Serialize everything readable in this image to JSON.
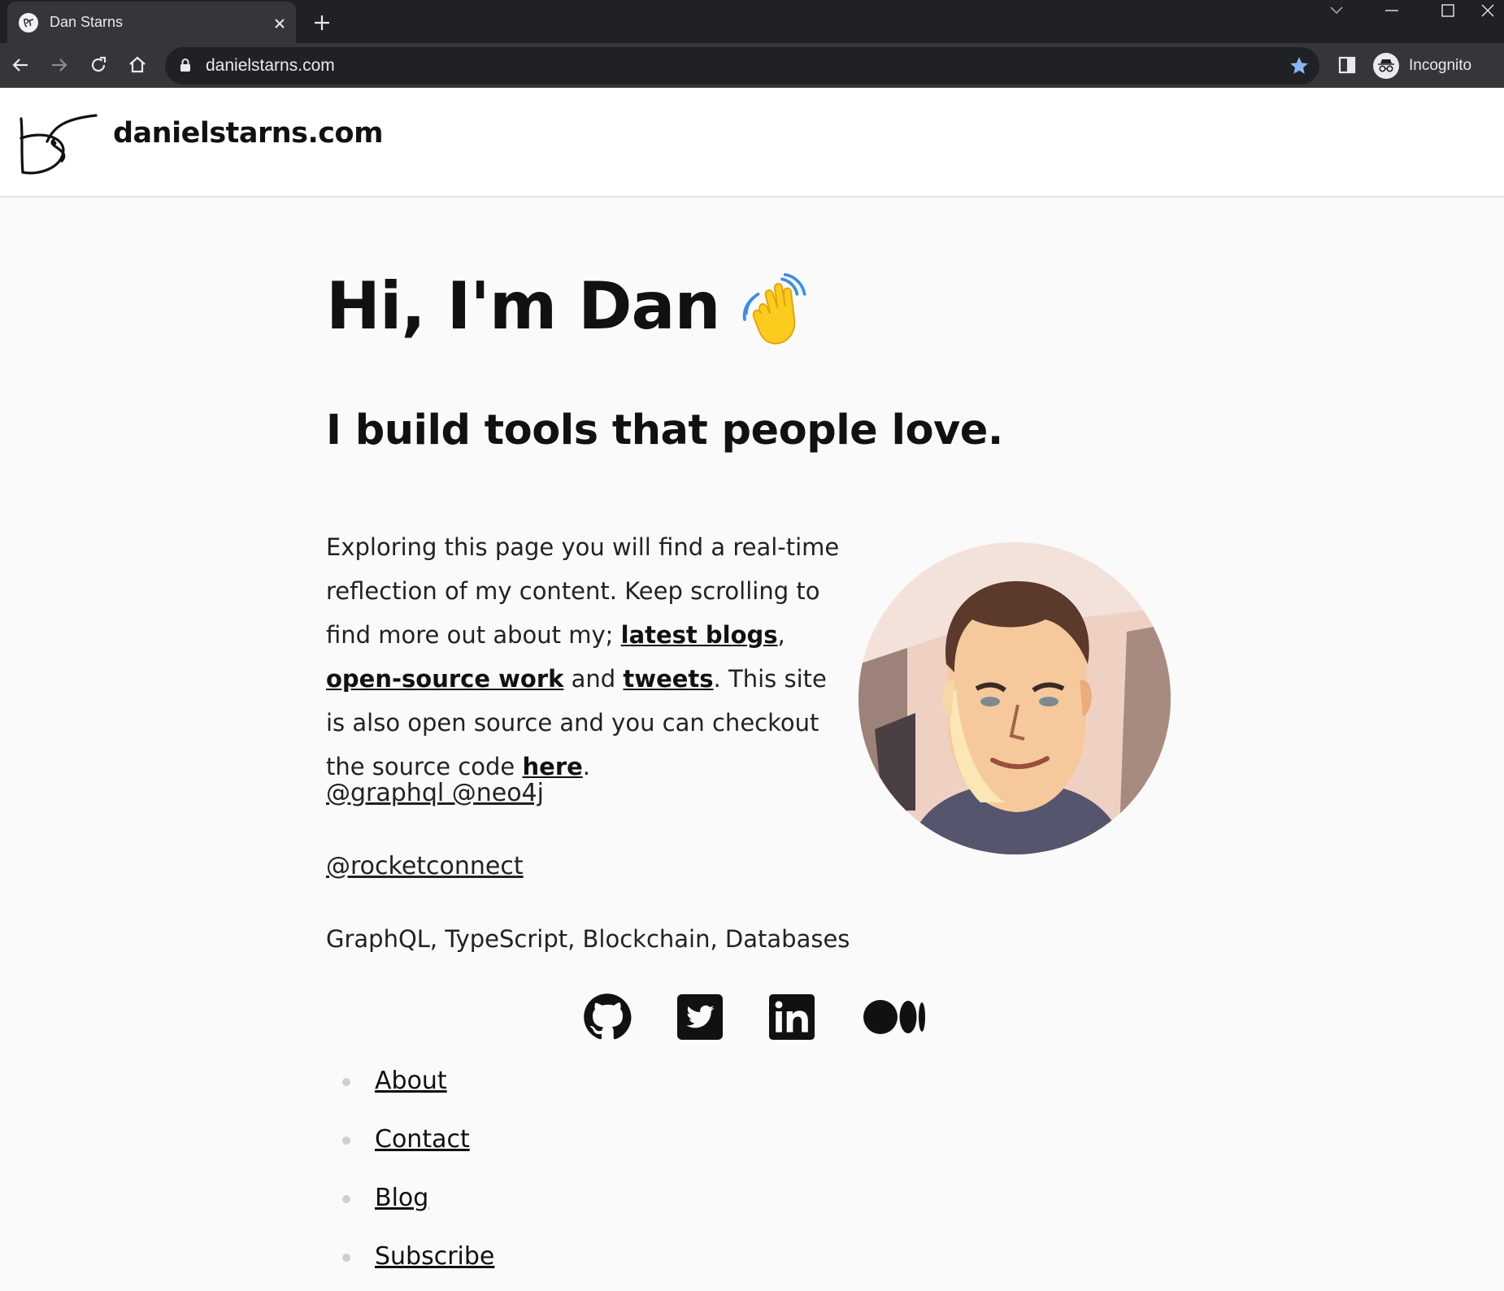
{
  "browser": {
    "tab_title": "Dan Starns",
    "url": "danielstarns.com",
    "profile_label": "Incognito"
  },
  "header": {
    "site_name": "danielstarns.com"
  },
  "hero": {
    "title": "Hi, I'm Dan",
    "subtitle": "I build tools that people love."
  },
  "intro": {
    "part1": "Exploring this page you will find a real-time reflection of my content. Keep scrolling to find more out about my; ",
    "link_blogs": "latest blogs",
    "sep1": ", ",
    "link_oss": "open-source work",
    "sep2": " and ",
    "link_tweets": "tweets",
    "part2": ". This site is also open source and you can checkout the source code ",
    "link_here": "here",
    "part3": "."
  },
  "handles": {
    "work": "@graphql @neo4j",
    "company": "@rocketconnect"
  },
  "interests": "GraphQL, TypeScript, Blockchain, Databases",
  "social": {
    "icons": [
      "github-icon",
      "twitter-icon",
      "linkedin-icon",
      "medium-icon"
    ]
  },
  "nav": {
    "items": [
      "About",
      "Contact",
      "Blog",
      "Subscribe"
    ]
  },
  "colors": {
    "chrome_dark": "#202124",
    "chrome_toolbar": "#35363a",
    "page_bg": "#fafafa",
    "text": "#111111",
    "star_accent": "#8ab4f8"
  }
}
